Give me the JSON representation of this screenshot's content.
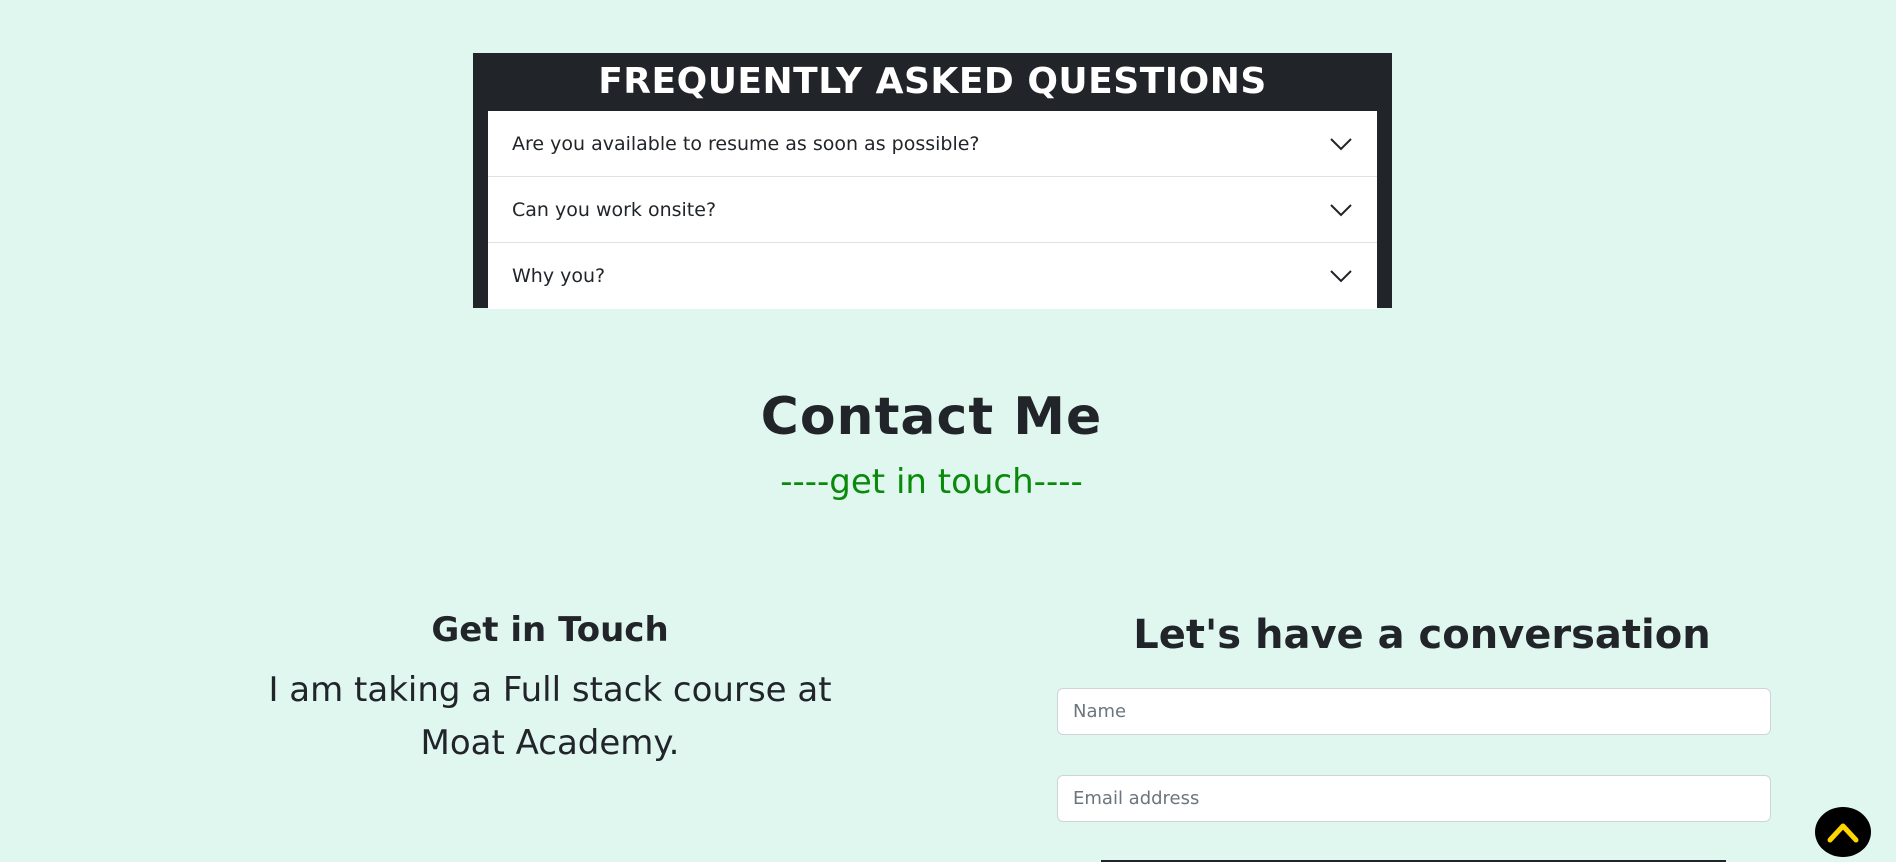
{
  "faq": {
    "title": "FREQUENTLY ASKED QUESTIONS",
    "items": [
      {
        "question": "Are you available to resume as soon as possible?"
      },
      {
        "question": "Can you work onsite?"
      },
      {
        "question": "Why you?"
      }
    ]
  },
  "contact": {
    "title": "Contact Me",
    "subtitle": "----get in touch----",
    "get_in_touch": {
      "heading": "Get in Touch",
      "text": "I am taking a Full stack course at Moat Academy."
    },
    "form": {
      "heading": "Let's have a conversation",
      "name_placeholder": "Name",
      "email_placeholder": "Email address"
    }
  },
  "icons": {
    "faq_toggle": "chevron-down-icon",
    "scroll_top": "chevron-up-icon"
  },
  "colors": {
    "page_background": "#e0f7f0",
    "faq_background": "#212529",
    "subtitle": "#0a8a0a",
    "scroll_top_arrow": "#ffd500"
  }
}
